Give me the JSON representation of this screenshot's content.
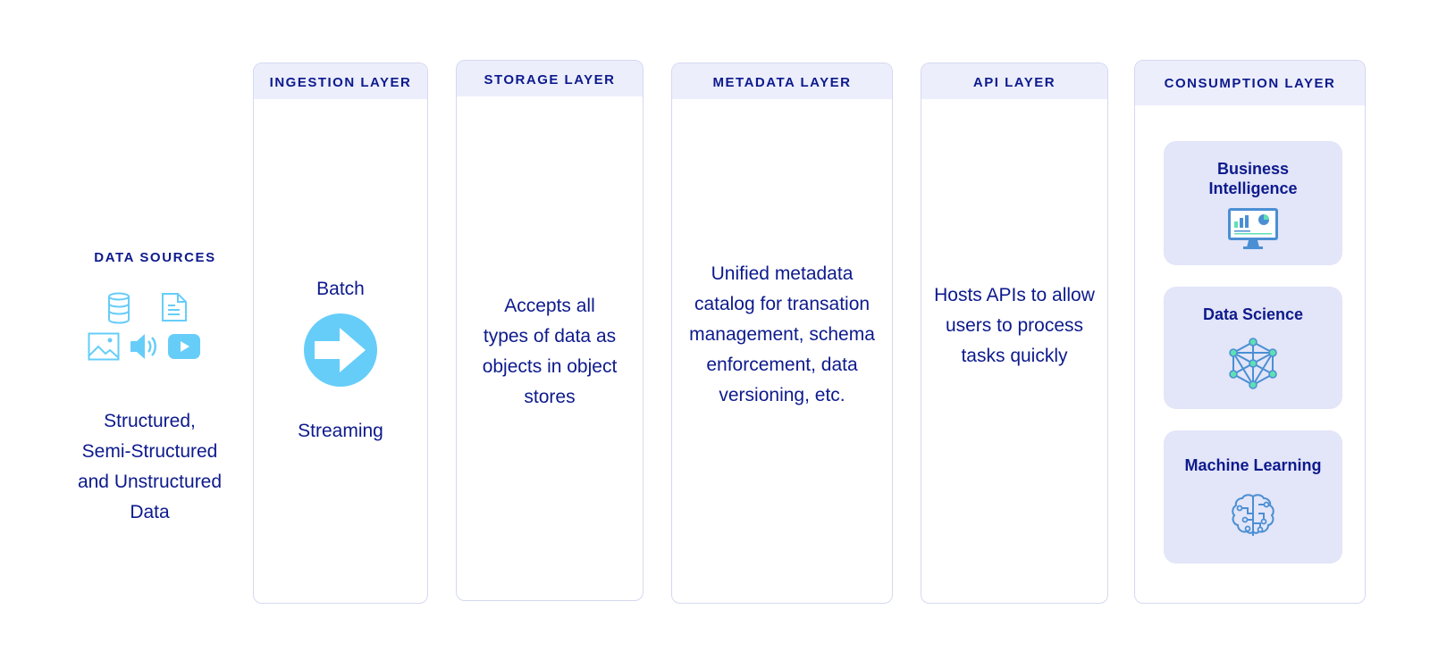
{
  "data_sources": {
    "title": "DATA SOURCES",
    "icons": [
      "database-icon",
      "document-icon",
      "image-icon",
      "audio-icon",
      "video-icon"
    ],
    "description_lines": [
      "Structured,",
      "Semi-Structured",
      "and Unstructured",
      "Data"
    ]
  },
  "layers": [
    {
      "title": "INGESTION LAYER",
      "top_label": "Batch",
      "icon": "arrow-right-icon",
      "bottom_label": "Streaming"
    },
    {
      "title": "STORAGE LAYER",
      "description_lines": [
        "Accepts all",
        "types of data as",
        "objects in object",
        "stores"
      ]
    },
    {
      "title": "METADATA LAYER",
      "description_lines": [
        "Unified metadata",
        "catalog for transation",
        "management, schema",
        "enforcement, data",
        "versioning, etc."
      ]
    },
    {
      "title": "API LAYER",
      "description_lines": [
        "Hosts APIs to allow",
        "users to process",
        "tasks quickly"
      ]
    },
    {
      "title": "CONSUMPTION LAYER",
      "cards": [
        {
          "label_lines": [
            "Business",
            "Intelligence"
          ],
          "icon": "dashboard-monitor-icon"
        },
        {
          "label_lines": [
            "Data Science"
          ],
          "icon": "network-graph-icon"
        },
        {
          "label_lines": [
            "Machine Learning"
          ],
          "icon": "brain-circuit-icon"
        }
      ]
    }
  ],
  "colors": {
    "text": "#0d1a8c",
    "header_bg": "#eceefc",
    "border": "#d5d8f0",
    "card_bg": "#e3e5f8",
    "icon_blue": "#66cdf9",
    "icon_green": "#5ee0b3",
    "icon_stroke": "#4a8fd4"
  }
}
